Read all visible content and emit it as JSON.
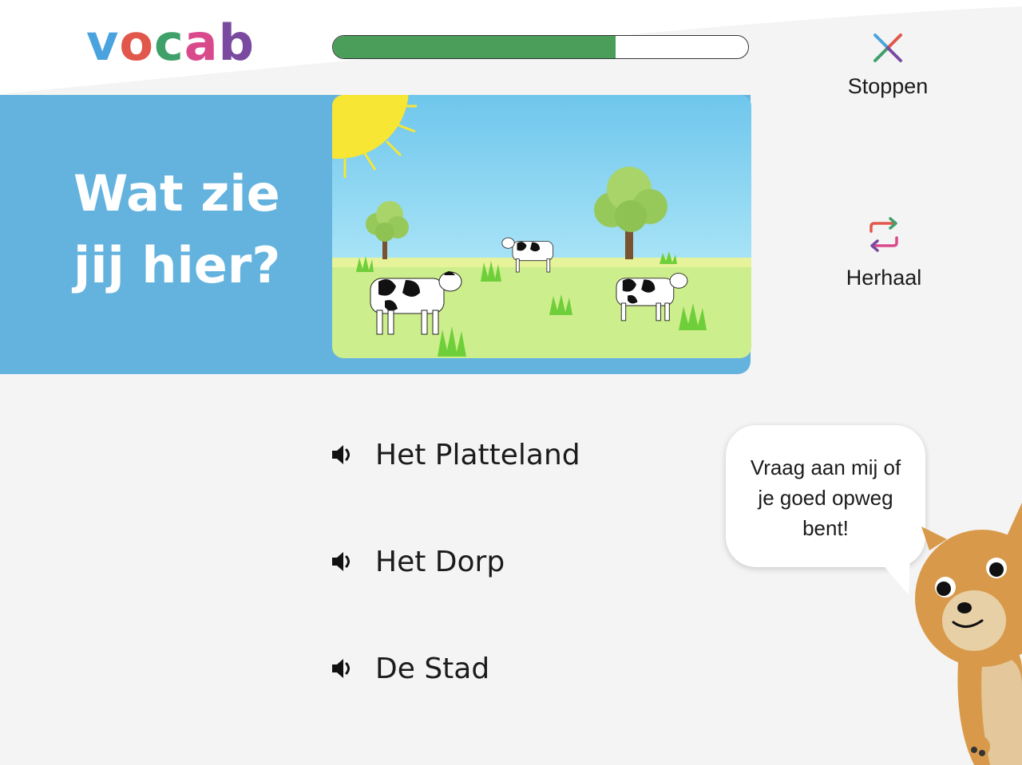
{
  "logo": {
    "letters": [
      "v",
      "o",
      "c",
      "a",
      "b"
    ],
    "colors": [
      "#4aa3df",
      "#e2574c",
      "#3fa06a",
      "#d94a8c",
      "#7a4aa0"
    ]
  },
  "progress": {
    "value": 0.68,
    "fill_color": "#4a9e5a"
  },
  "header": {
    "stop_label": "Stoppen",
    "repeat_label": "Herhaal",
    "stop_icon": "close-icon",
    "repeat_icon": "repeat-icon"
  },
  "question": {
    "line1": "Wat zie",
    "line2": "jij hier?"
  },
  "scene": {
    "description_icon": "countryside-image"
  },
  "answers": [
    {
      "label": "Het Platteland",
      "icon": "speaker-icon"
    },
    {
      "label": "Het Dorp",
      "icon": "speaker-icon"
    },
    {
      "label": "De Stad",
      "icon": "speaker-icon"
    }
  ],
  "mascot": {
    "speech": "Vraag aan mij of je goed opweg bent!",
    "speech_lines": [
      "Vraag aan mij of",
      "je goed opweg",
      "bent!"
    ]
  },
  "colors": {
    "banner": "#64b3de",
    "background": "#f4f4f4"
  }
}
